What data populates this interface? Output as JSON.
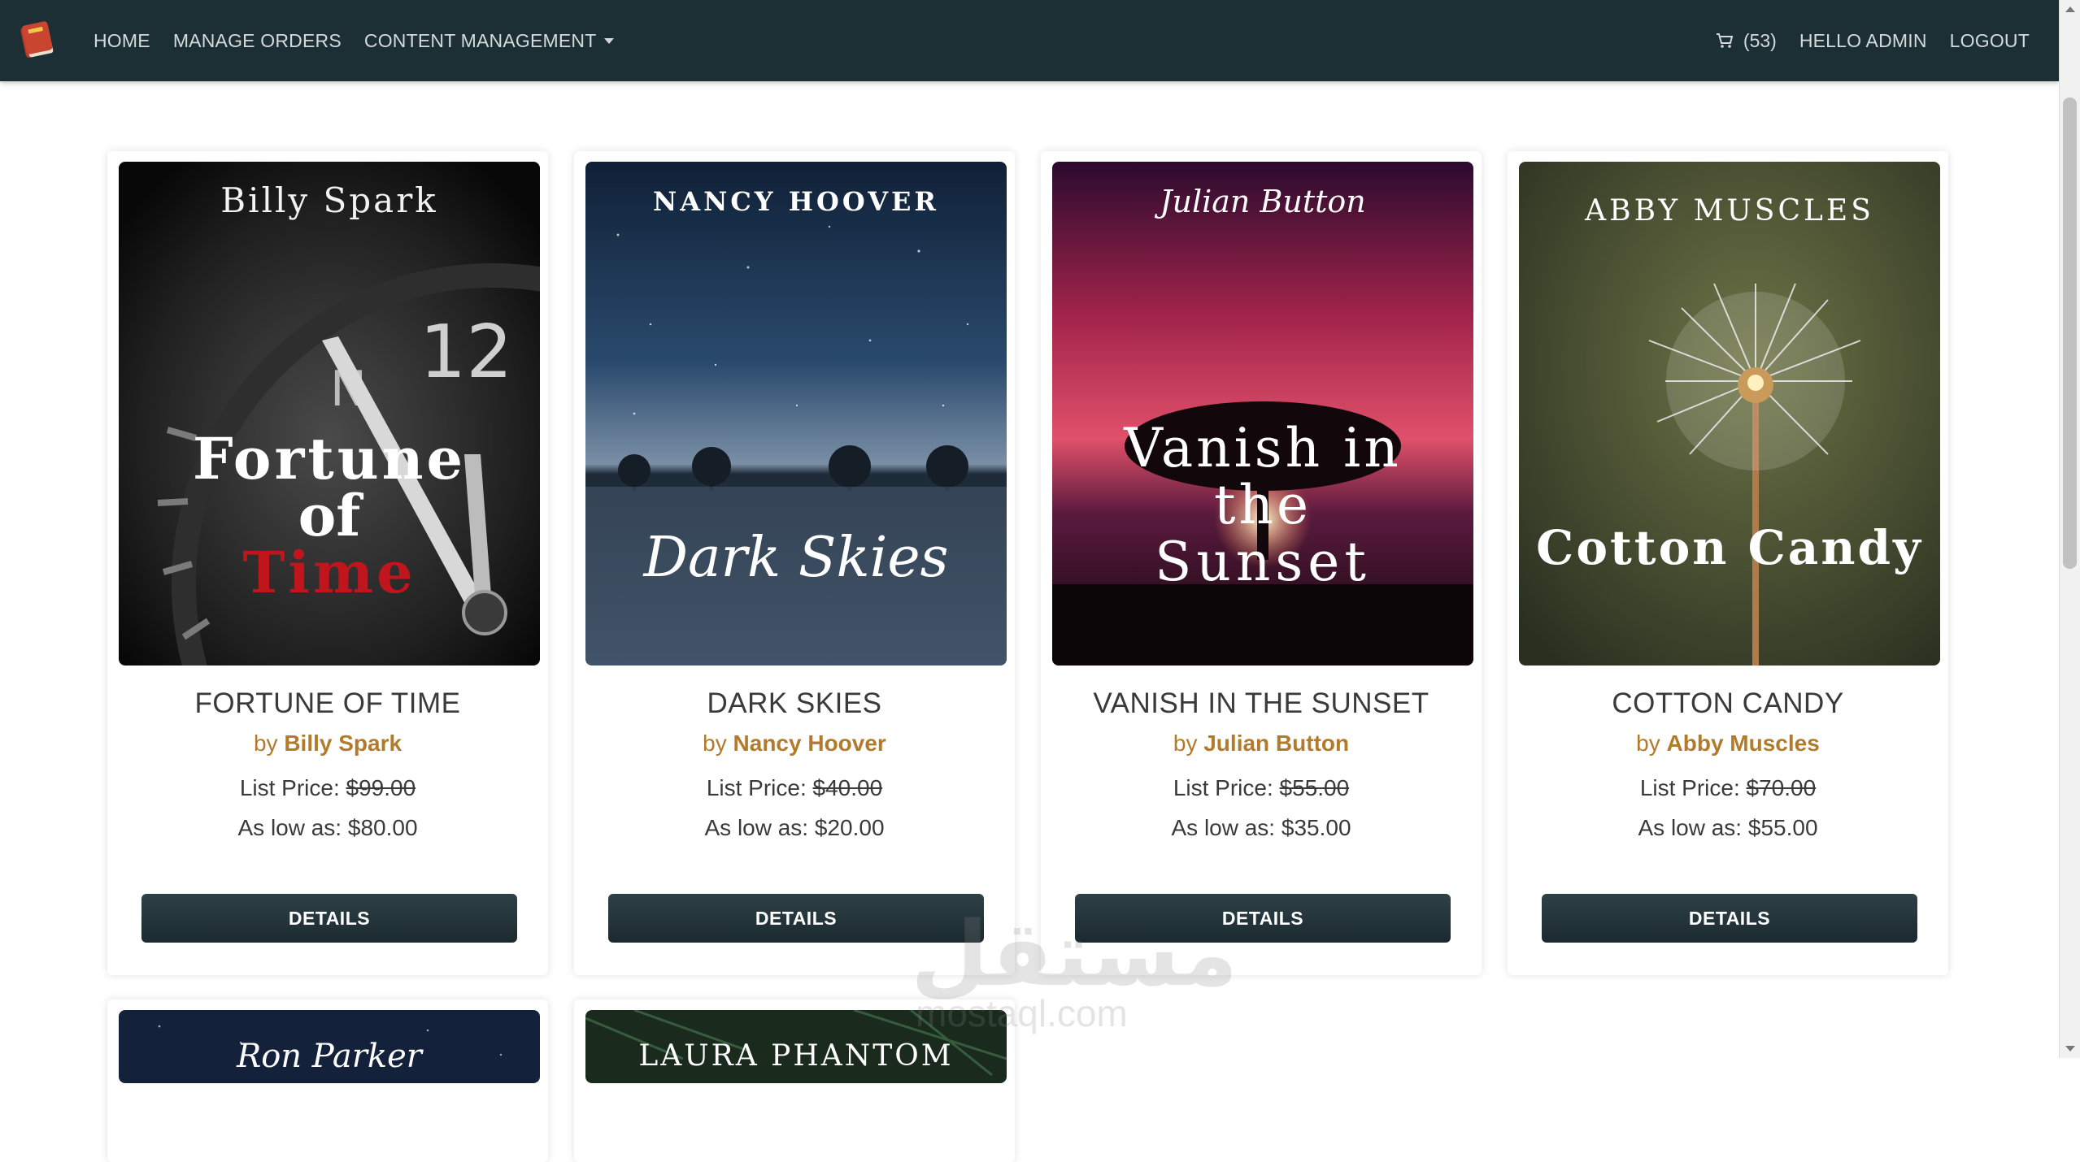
{
  "nav": {
    "brand_icon": "book-logo-icon",
    "links": [
      "HOME",
      "MANAGE ORDERS",
      "CONTENT MANAGEMENT"
    ],
    "cart_count": "(53)",
    "greeting": "HELLO ADMIN",
    "logout": "LOGOUT"
  },
  "books": [
    {
      "cover_author": "Billy Spark",
      "cover_title_1": "Fortune",
      "cover_title_2": "of",
      "cover_title_3": "Time",
      "title": "FORTUNE OF TIME",
      "by": "by",
      "author": "Billy Spark",
      "list_label": "List Price:",
      "list_price": "$99.00",
      "low_label": "As low as:",
      "low_price": "$80.00",
      "button": "DETAILS"
    },
    {
      "cover_author": "NANCY HOOVER",
      "cover_title_1": "Dark Skies",
      "title": "DARK SKIES",
      "by": "by",
      "author": "Nancy Hoover",
      "list_label": "List Price:",
      "list_price": "$40.00",
      "low_label": "As low as:",
      "low_price": "$20.00",
      "button": "DETAILS"
    },
    {
      "cover_author": "Julian Button",
      "cover_title_1": "Vanish in",
      "cover_title_2": "the",
      "cover_title_3": "Sunset",
      "title": "VANISH IN THE SUNSET",
      "by": "by",
      "author": "Julian Button",
      "list_label": "List Price:",
      "list_price": "$55.00",
      "low_label": "As low as:",
      "low_price": "$35.00",
      "button": "DETAILS"
    },
    {
      "cover_author": "ABBY MUSCLES",
      "cover_title_1": "Cotton Candy",
      "title": "COTTON CANDY",
      "by": "by",
      "author": "Abby Muscles",
      "list_label": "List Price:",
      "list_price": "$70.00",
      "low_label": "As low as:",
      "low_price": "$55.00",
      "button": "DETAILS"
    }
  ],
  "partial_books": [
    {
      "cover_author": "Ron Parker"
    },
    {
      "cover_author": "LAURA PHANTOM"
    }
  ],
  "watermark": {
    "arabic": "مستقل",
    "latin": "mostaql.com"
  },
  "colors": {
    "navbar": "#1c2f35",
    "author_accent": "#b27b2c",
    "button": "#24363c"
  }
}
